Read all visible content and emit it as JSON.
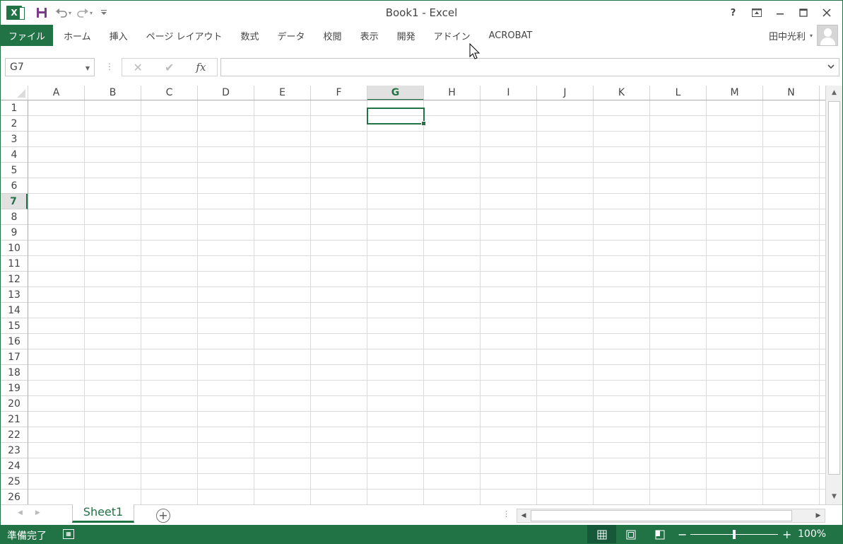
{
  "window": {
    "title": "Book1 - Excel",
    "accent": "#217346"
  },
  "qat": {
    "logo_letter": "X",
    "save_icon": "save-icon",
    "undo_icon": "undo-icon",
    "redo_icon": "redo-icon",
    "customize_icon": "customize-qat-icon"
  },
  "window_controls": {
    "help": "?",
    "ribbon_display": "⧈",
    "minimize": "—",
    "maximize": "☐",
    "close": "✕"
  },
  "ribbon": {
    "file_tab": "ファイル",
    "tabs": [
      "ホーム",
      "挿入",
      "ページ レイアウト",
      "数式",
      "データ",
      "校閲",
      "表示",
      "開発",
      "アドイン",
      "ACROBAT"
    ],
    "user_name": "田中光利"
  },
  "formula_bar": {
    "name_box": "G7",
    "cancel_icon": "✕",
    "enter_icon": "✔",
    "fx_label": "fx",
    "formula_value": ""
  },
  "grid": {
    "columns": [
      "A",
      "B",
      "C",
      "D",
      "E",
      "F",
      "G",
      "H",
      "I",
      "J",
      "K",
      "L",
      "M",
      "N"
    ],
    "rows": [
      "1",
      "2",
      "3",
      "4",
      "5",
      "6",
      "7",
      "8",
      "9",
      "10",
      "11",
      "12",
      "13",
      "14",
      "15",
      "16",
      "17",
      "18",
      "19",
      "20",
      "21",
      "22",
      "23",
      "24",
      "25",
      "26"
    ],
    "selected_column": "G",
    "selected_row": "7"
  },
  "sheets": {
    "tabs": [
      "Sheet1"
    ],
    "add_label": "+"
  },
  "status": {
    "text": "準備完了",
    "zoom": "100%"
  }
}
